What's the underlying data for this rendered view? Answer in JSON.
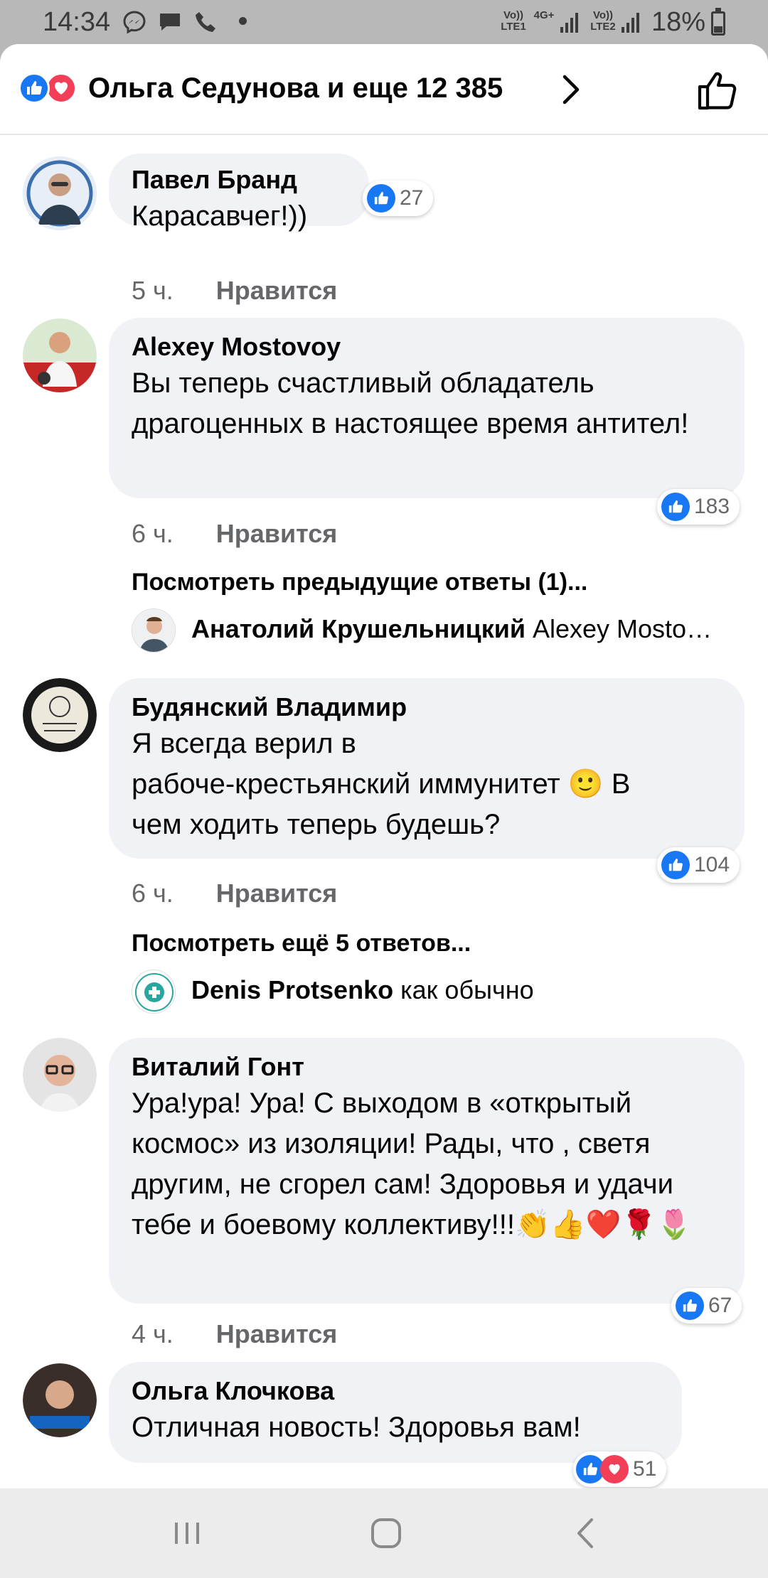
{
  "status_bar": {
    "time": "14:34",
    "icons": [
      "messenger-icon",
      "chat-icon",
      "phone-icon"
    ],
    "sim1": "Vo)) LTE1",
    "sim1_net": "4G+",
    "sim2": "Vo)) LTE2",
    "battery": "18%"
  },
  "header": {
    "title": "Ольга Седунова и еще 12 385",
    "reactions": [
      "like",
      "love"
    ]
  },
  "comments": [
    {
      "author": "Павел Бранд",
      "text": "Карасавчег!))",
      "time": "5 ч.",
      "like_label": "Нравится",
      "reactions": "27"
    },
    {
      "author": "Alexey Mostovoy",
      "text": "Вы теперь счастливый обладатель драгоценных в настоящее время антител!",
      "time": "6 ч.",
      "like_label": "Нравится",
      "reactions": "183",
      "more_link": "Посмотреть предыдущие ответы (1)...",
      "reply": {
        "author": "Анатолий Крушельницкий",
        "text": "Alexey Mosto…"
      }
    },
    {
      "author": "Будянский Владимир",
      "text_line1": "Я всегда верил в",
      "text_line2": "рабоче-крестьянский иммунитет",
      "text_emoji": "🙂",
      "text_line2b": " В",
      "text_line3": "чем ходить теперь будешь?",
      "time": "6 ч.",
      "like_label": "Нравится",
      "reactions": "104",
      "more_link": "Посмотреть ещё 5 ответов...",
      "reply": {
        "author": "Denis Protsenko",
        "text": "как обычно"
      }
    },
    {
      "author": "Виталий Гонт",
      "text": "Ура!ура! Ура! С выходом в «открытый космос» из изоляции! Рады, что , светя другим, не сгорел сам! Здоровья и удачи тебе и боевому коллективу!!!👏👍❤️🌹🌷",
      "time": "4 ч.",
      "like_label": "Нравится",
      "reactions": "67"
    },
    {
      "author": "Ольга Клочкова",
      "text": "Отличная новость! Здоровья вам!",
      "reactions": "51"
    }
  ],
  "nav": {
    "icons": [
      "recent-apps-icon",
      "home-icon",
      "back-icon"
    ]
  },
  "colors": {
    "accent": "#1877f2",
    "love": "#f33e58",
    "bubble": "#f0f2f5",
    "meta": "#65676b"
  }
}
